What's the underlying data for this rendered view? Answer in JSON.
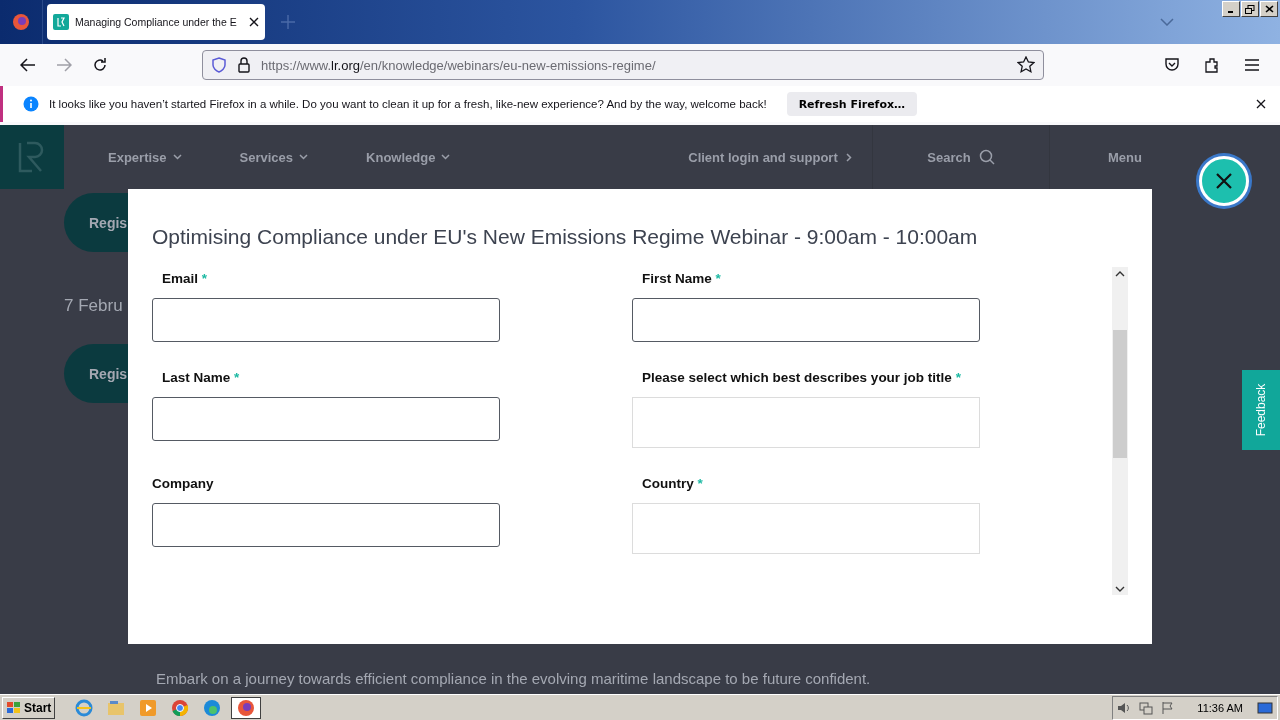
{
  "browser": {
    "tab": {
      "title": "Managing Compliance under the E"
    },
    "url": {
      "scheme": "https://www.",
      "domain": "lr.org",
      "path": "/en/knowledge/webinars/eu-new-emissions-regime/"
    },
    "notification": {
      "message": "It looks like you haven’t started Firefox in a while. Do you want to clean it up for a fresh, like-new experience? And by the way, welcome back!",
      "button": "Refresh Firefox…"
    }
  },
  "site": {
    "nav": [
      {
        "label": "Expertise"
      },
      {
        "label": "Services"
      },
      {
        "label": "Knowledge"
      }
    ],
    "client_link": "Client login and support",
    "search": "Search",
    "menu": "Menu",
    "register_buttons": [
      "Regis",
      "Regis"
    ],
    "date": "7 Febru",
    "intro": "Embark on a journey towards efficient compliance in the evolving maritime landscape to be future confident."
  },
  "modal": {
    "title": "Optimising Compliance under EU's New Emissions Regime Webinar - 9:00am - 10:00am",
    "fields": [
      {
        "label": "Email",
        "required_mark": "*",
        "kind": "text"
      },
      {
        "label": "First Name",
        "required_mark": "*",
        "kind": "text"
      },
      {
        "label": "Last Name",
        "required_mark": "*",
        "kind": "text"
      },
      {
        "label": "Please select which best describes your job title",
        "required_mark": "*",
        "kind": "select"
      },
      {
        "label": "Company",
        "kind": "text"
      },
      {
        "label": "Country",
        "required_mark": "*",
        "kind": "select"
      }
    ]
  },
  "feedback": "Feedback",
  "taskbar": {
    "start": "Start",
    "clock": "11:36 AM"
  }
}
